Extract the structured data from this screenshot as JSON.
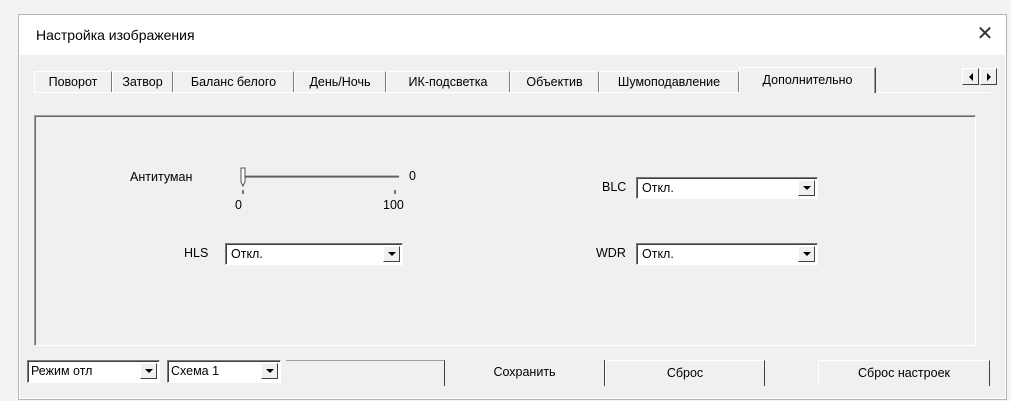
{
  "dialog": {
    "title": "Настройка изображения",
    "close_glyph": "✕"
  },
  "tabs": [
    {
      "label": "Поворот",
      "active": false
    },
    {
      "label": "Затвор",
      "active": false
    },
    {
      "label": "Баланс белого",
      "active": false
    },
    {
      "label": "День/Ночь",
      "active": false
    },
    {
      "label": "ИК-подсветка",
      "active": false
    },
    {
      "label": "Объектив",
      "active": false
    },
    {
      "label": "Шумоподавление",
      "active": false
    },
    {
      "label": "Дополнительно",
      "active": true
    }
  ],
  "tab_scroll": {
    "left_icon": "arrow-left-icon",
    "right_icon": "arrow-right-icon"
  },
  "settings": {
    "defog": {
      "label": "Антитуман",
      "value": "0",
      "min": "0",
      "max": "100",
      "level": 0
    },
    "blc": {
      "label": "BLC",
      "value": "Откл."
    },
    "hls": {
      "label": "HLS",
      "value": "Откл."
    },
    "wdr": {
      "label": "WDR",
      "value": "Откл."
    }
  },
  "bottom": {
    "mode_select": "Режим отл",
    "scheme_select": "Схема 1",
    "save_label": "Сохранить",
    "reset_label": "Сброс",
    "factory_reset_label": "Сброс настроек"
  },
  "colors": {
    "window_bg": "#f0f0f0",
    "titlebar_bg": "#ffffff"
  }
}
